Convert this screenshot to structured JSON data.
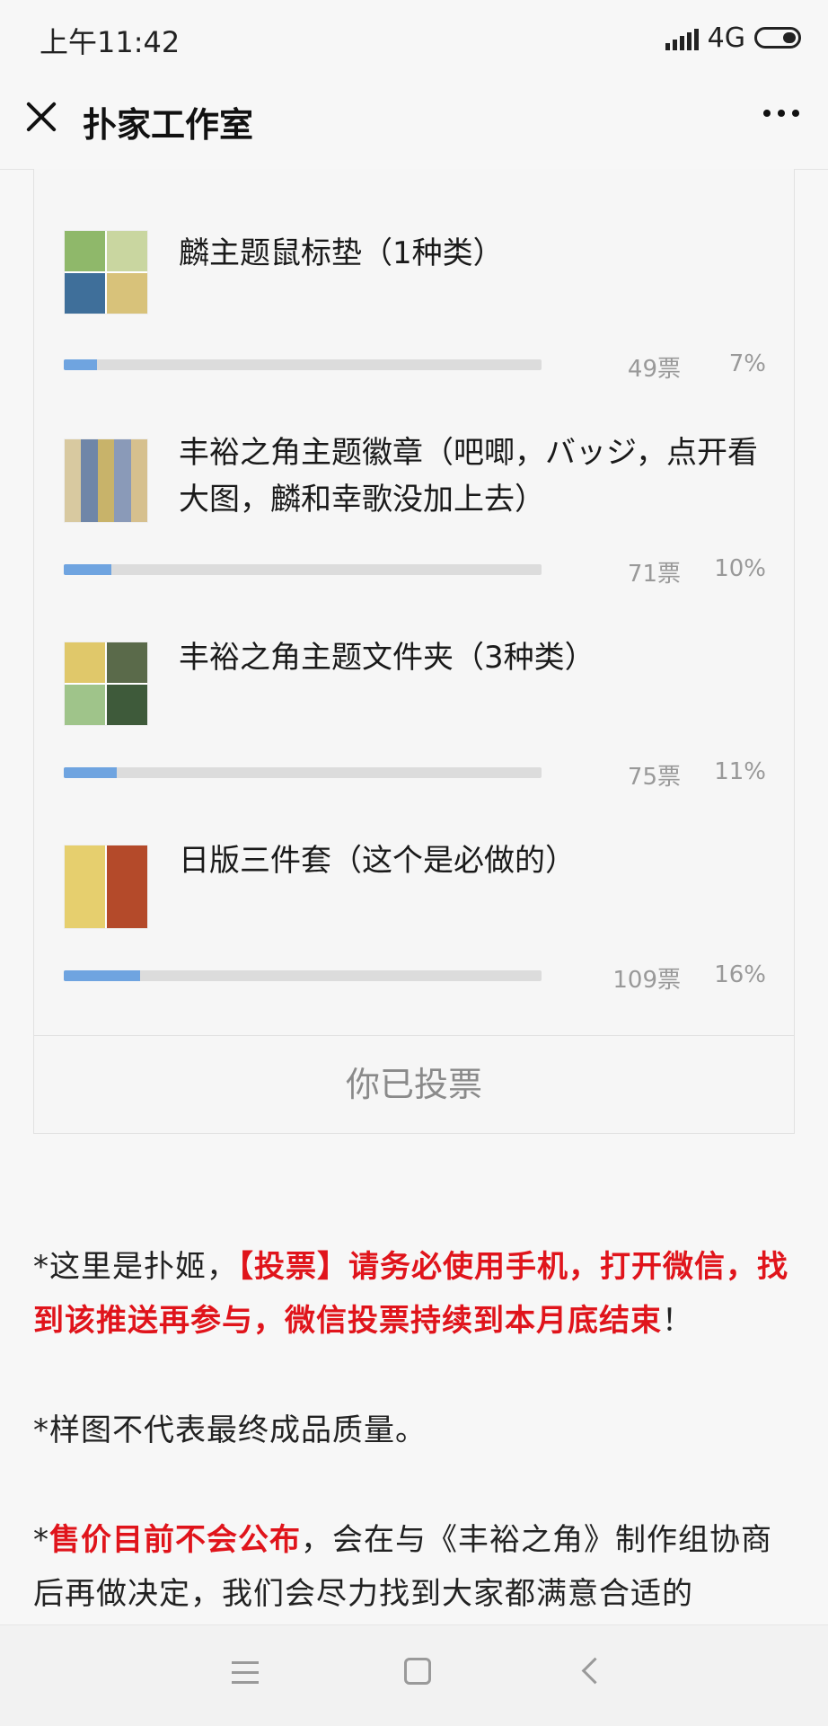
{
  "status_bar": {
    "time": "上午11:42",
    "network": "4G"
  },
  "nav": {
    "title": "扑家工作室"
  },
  "poll": {
    "options": [
      {
        "label": "麟主题鼠标垫（1种类）",
        "votes": "49票",
        "percent": "7%",
        "fraction": 0.07
      },
      {
        "label": "丰裕之角主题徽章（吧唧，バッジ，点开看大图，麟和幸歌没加上去）",
        "votes": "71票",
        "percent": "10%",
        "fraction": 0.1
      },
      {
        "label": "丰裕之角主题文件夹（3种类）",
        "votes": "75票",
        "percent": "11%",
        "fraction": 0.11
      },
      {
        "label": "日版三件套（这个是必做的）",
        "votes": "109票",
        "percent": "16%",
        "fraction": 0.16
      }
    ],
    "voted_label": "你已投票"
  },
  "article": {
    "p1_a": "*这里是扑姬，",
    "p1_red": "【投票】请务必使用手机，打开微信，找到该推送再参与，微信投票持续到本月底结束",
    "p1_b": "！",
    "p2": "*样图不代表最终成品质量。",
    "p3_a": "*",
    "p3_red": "售价目前不会公布",
    "p3_b": "，会在与《丰裕之角》制作组协商后再做决定，我们会尽力找到大家都满意合适的"
  },
  "colors": {
    "accent_bar": "#6fa4e0",
    "highlight_red": "#e0141b"
  }
}
